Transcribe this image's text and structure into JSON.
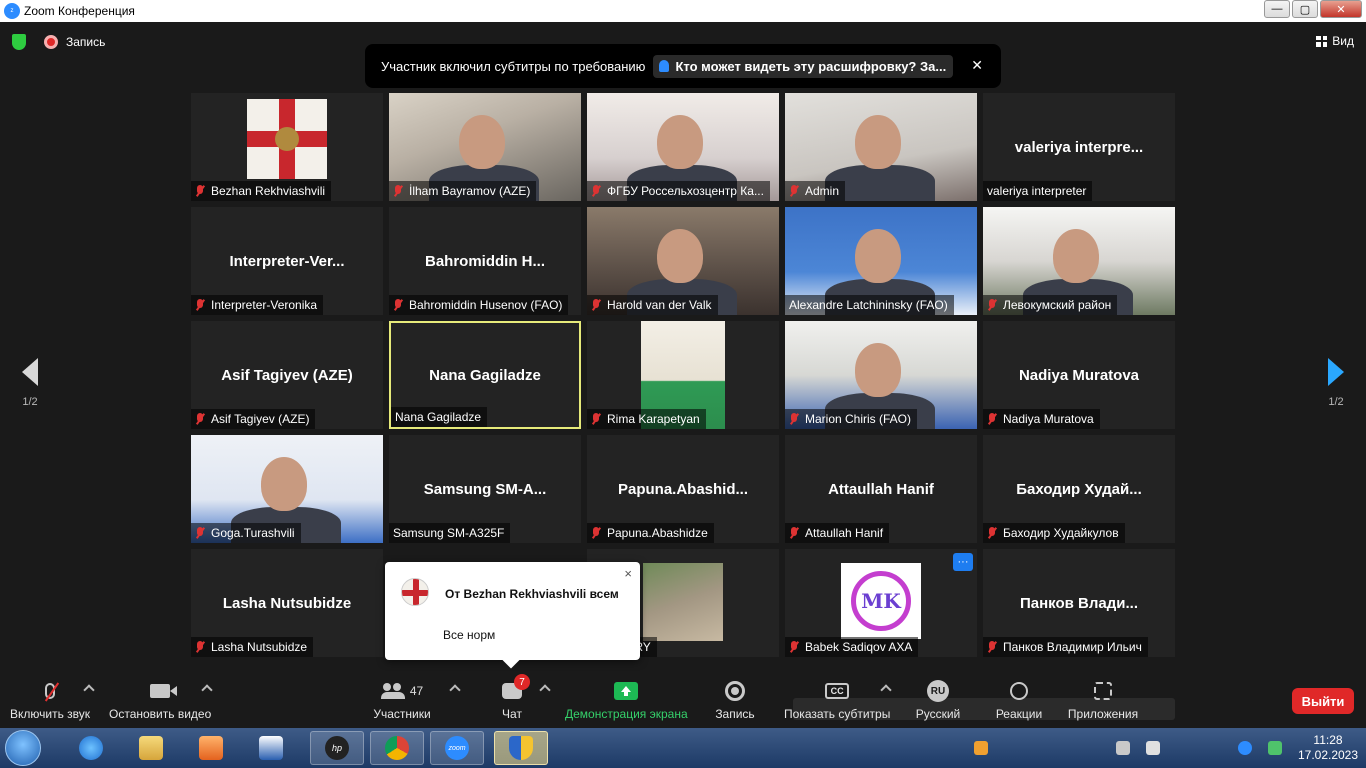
{
  "window": {
    "title": "Zoom Конференция",
    "app_icon": "zoom-app-icon"
  },
  "topbar": {
    "record_label": "Запись",
    "view_label": "Вид"
  },
  "banner": {
    "text": "Участник включил субтитры по требованию",
    "link": "Кто может видеть эту расшифровку? За..."
  },
  "tiles": [
    {
      "name": "Bezhan Rekhviashvili",
      "center": "",
      "muted": true,
      "kind": "flag"
    },
    {
      "name": "İlham Bayramov (AZE)",
      "center": "",
      "muted": true,
      "kind": "video-a"
    },
    {
      "name": "ФГБУ Россельхозцентр Ка...",
      "center": "",
      "muted": true,
      "kind": "video-b"
    },
    {
      "name": "Admin",
      "center": "",
      "muted": true,
      "kind": "video-c"
    },
    {
      "name": "valeriya interpreter",
      "center": "valeriya  interpre...",
      "muted": false,
      "kind": "text"
    },
    {
      "name": "Interpreter-Veronika",
      "center": "Interpreter-Ver...",
      "muted": true,
      "kind": "text"
    },
    {
      "name": "Bahromiddin Husenov (FAO)",
      "center": "Bahromiddin  H...",
      "muted": true,
      "kind": "text"
    },
    {
      "name": "Harold van der Valk",
      "center": "",
      "muted": true,
      "kind": "video-d"
    },
    {
      "name": "Alexandre Latchininsky (FAO)",
      "center": "",
      "muted": false,
      "kind": "video-e"
    },
    {
      "name": "Левокумский район",
      "center": "",
      "muted": true,
      "kind": "video-f"
    },
    {
      "name": "Asif Tagiyev (AZE)",
      "center": "Asif Tagiyev (AZE)",
      "muted": true,
      "kind": "text"
    },
    {
      "name": "Nana Gagiladze",
      "center": "Nana Gagiladze",
      "muted": false,
      "kind": "text",
      "active": true
    },
    {
      "name": "Rima Karapetyan",
      "center": "",
      "muted": true,
      "kind": "photo"
    },
    {
      "name": "Marion Chiris (FAO)",
      "center": "",
      "muted": true,
      "kind": "video-h"
    },
    {
      "name": "Nadiya Muratova",
      "center": "Nadiya Muratova",
      "muted": true,
      "kind": "text"
    },
    {
      "name": "Goga.Turashvili",
      "center": "",
      "muted": true,
      "kind": "video-g"
    },
    {
      "name": "Samsung SM-A325F",
      "center": "Samsung  SM-A...",
      "muted": false,
      "kind": "text"
    },
    {
      "name": "Papuna.Abashidze",
      "center": "Papuna.Abashid...",
      "muted": true,
      "kind": "text"
    },
    {
      "name": "Attaullah Hanif",
      "center": "Attaullah Hanif",
      "muted": true,
      "kind": "text"
    },
    {
      "name": "Баходир Худайкулов",
      "center": "Баходир  Худай...",
      "muted": true,
      "kind": "text"
    },
    {
      "name": "Lasha Nutsubidze",
      "center": "Lasha Nutsubidze",
      "muted": true,
      "kind": "text"
    },
    {
      "name": "",
      "center": "",
      "muted": false,
      "kind": "hidden"
    },
    {
      "name": "D WINERY",
      "center": "",
      "muted": false,
      "kind": "photo-i"
    },
    {
      "name": "Babek Sadiqov AXA",
      "center": "",
      "muted": true,
      "kind": "logo",
      "more": "···"
    },
    {
      "name": "Панков Владимир Ильич",
      "center": "Панков  Влади...",
      "muted": true,
      "kind": "text"
    }
  ],
  "pagination": {
    "left": "1/2",
    "right": "1/2"
  },
  "chat_popup": {
    "sender": "От Bezhan Rekhviashvili всем",
    "message": "Все норм",
    "close": "×"
  },
  "toolbar": {
    "unmute": "Включить звук",
    "start_video": "Остановить видео",
    "participants": "Участники",
    "participants_count": "47",
    "chat": "Чат",
    "chat_badge": "7",
    "share": "Демонстрация экрана",
    "record": "Запись",
    "captions": "Показать субтитры",
    "cc_glyph": "CC",
    "language": "Русский",
    "language_glyph": "RU",
    "reactions": "Реакции",
    "apps": "Приложения",
    "leave": "Выйти"
  },
  "taskbar": {
    "time": "11:28",
    "date": "17.02.2023",
    "zoom_label": "zoom",
    "hp_label": "hp"
  },
  "colors": {
    "accent": "#2d8cff",
    "leave": "#e02828",
    "share": "#1db954",
    "active_border": "#e6ea7a"
  }
}
